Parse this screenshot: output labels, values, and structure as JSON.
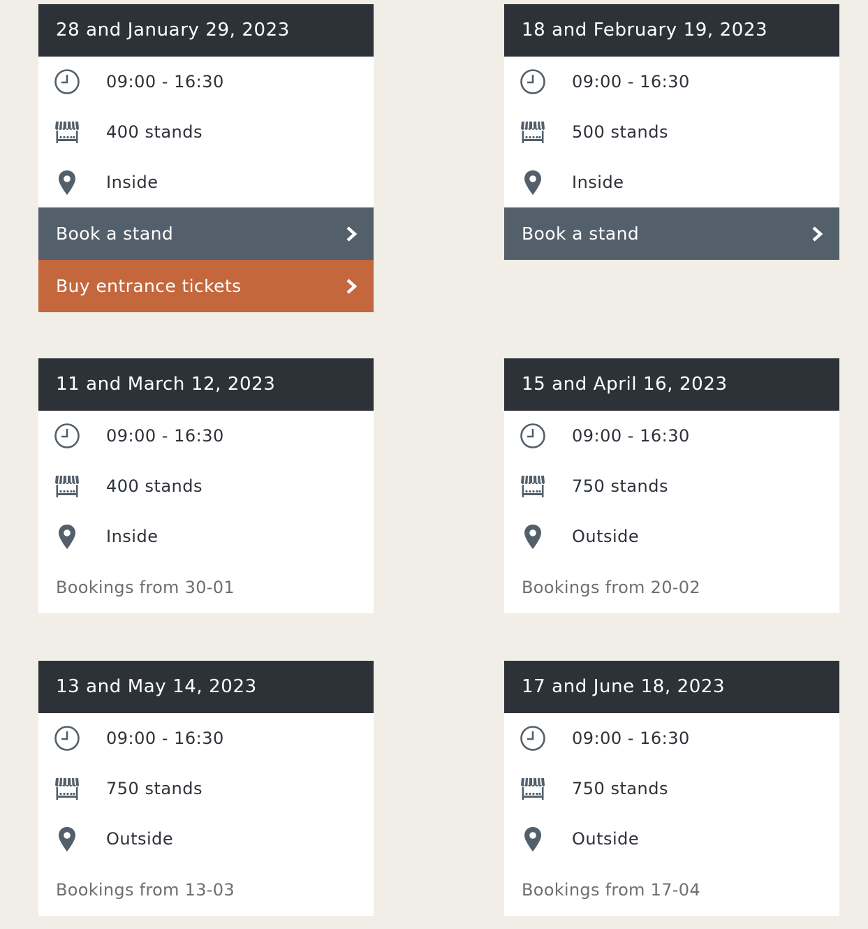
{
  "icons": {
    "time": "clock-icon",
    "stands": "market-stall-icon",
    "location": "map-pin-icon",
    "chevron": "chevron-right-icon"
  },
  "colors": {
    "header_bg": "#2d3239",
    "book_stand_bg": "#535f6a",
    "tickets_bg": "#c4673d",
    "page_bg": "#f1eee8"
  },
  "events": [
    {
      "date": "28 and January 29, 2023",
      "time": "09:00 - 16:30",
      "stands": "400 stands",
      "location": "Inside",
      "book_stand_label": "Book a stand",
      "tickets_label": "Buy entrance tickets"
    },
    {
      "date": "18 and February 19, 2023",
      "time": "09:00 - 16:30",
      "stands": "500 stands",
      "location": "Inside",
      "book_stand_label": "Book a stand"
    },
    {
      "date": "11 and March 12, 2023",
      "time": "09:00 - 16:30",
      "stands": "400 stands",
      "location": "Inside",
      "bookings": "Bookings from 30-01"
    },
    {
      "date": "15 and April 16, 2023",
      "time": "09:00 - 16:30",
      "stands": "750 stands",
      "location": "Outside",
      "bookings": "Bookings from 20-02"
    },
    {
      "date": "13 and May 14, 2023",
      "time": "09:00 - 16:30",
      "stands": "750 stands",
      "location": "Outside",
      "bookings": "Bookings from 13-03"
    },
    {
      "date": "17 and June 18, 2023",
      "time": "09:00 - 16:30",
      "stands": "750 stands",
      "location": "Outside",
      "bookings": "Bookings from 17-04"
    }
  ]
}
